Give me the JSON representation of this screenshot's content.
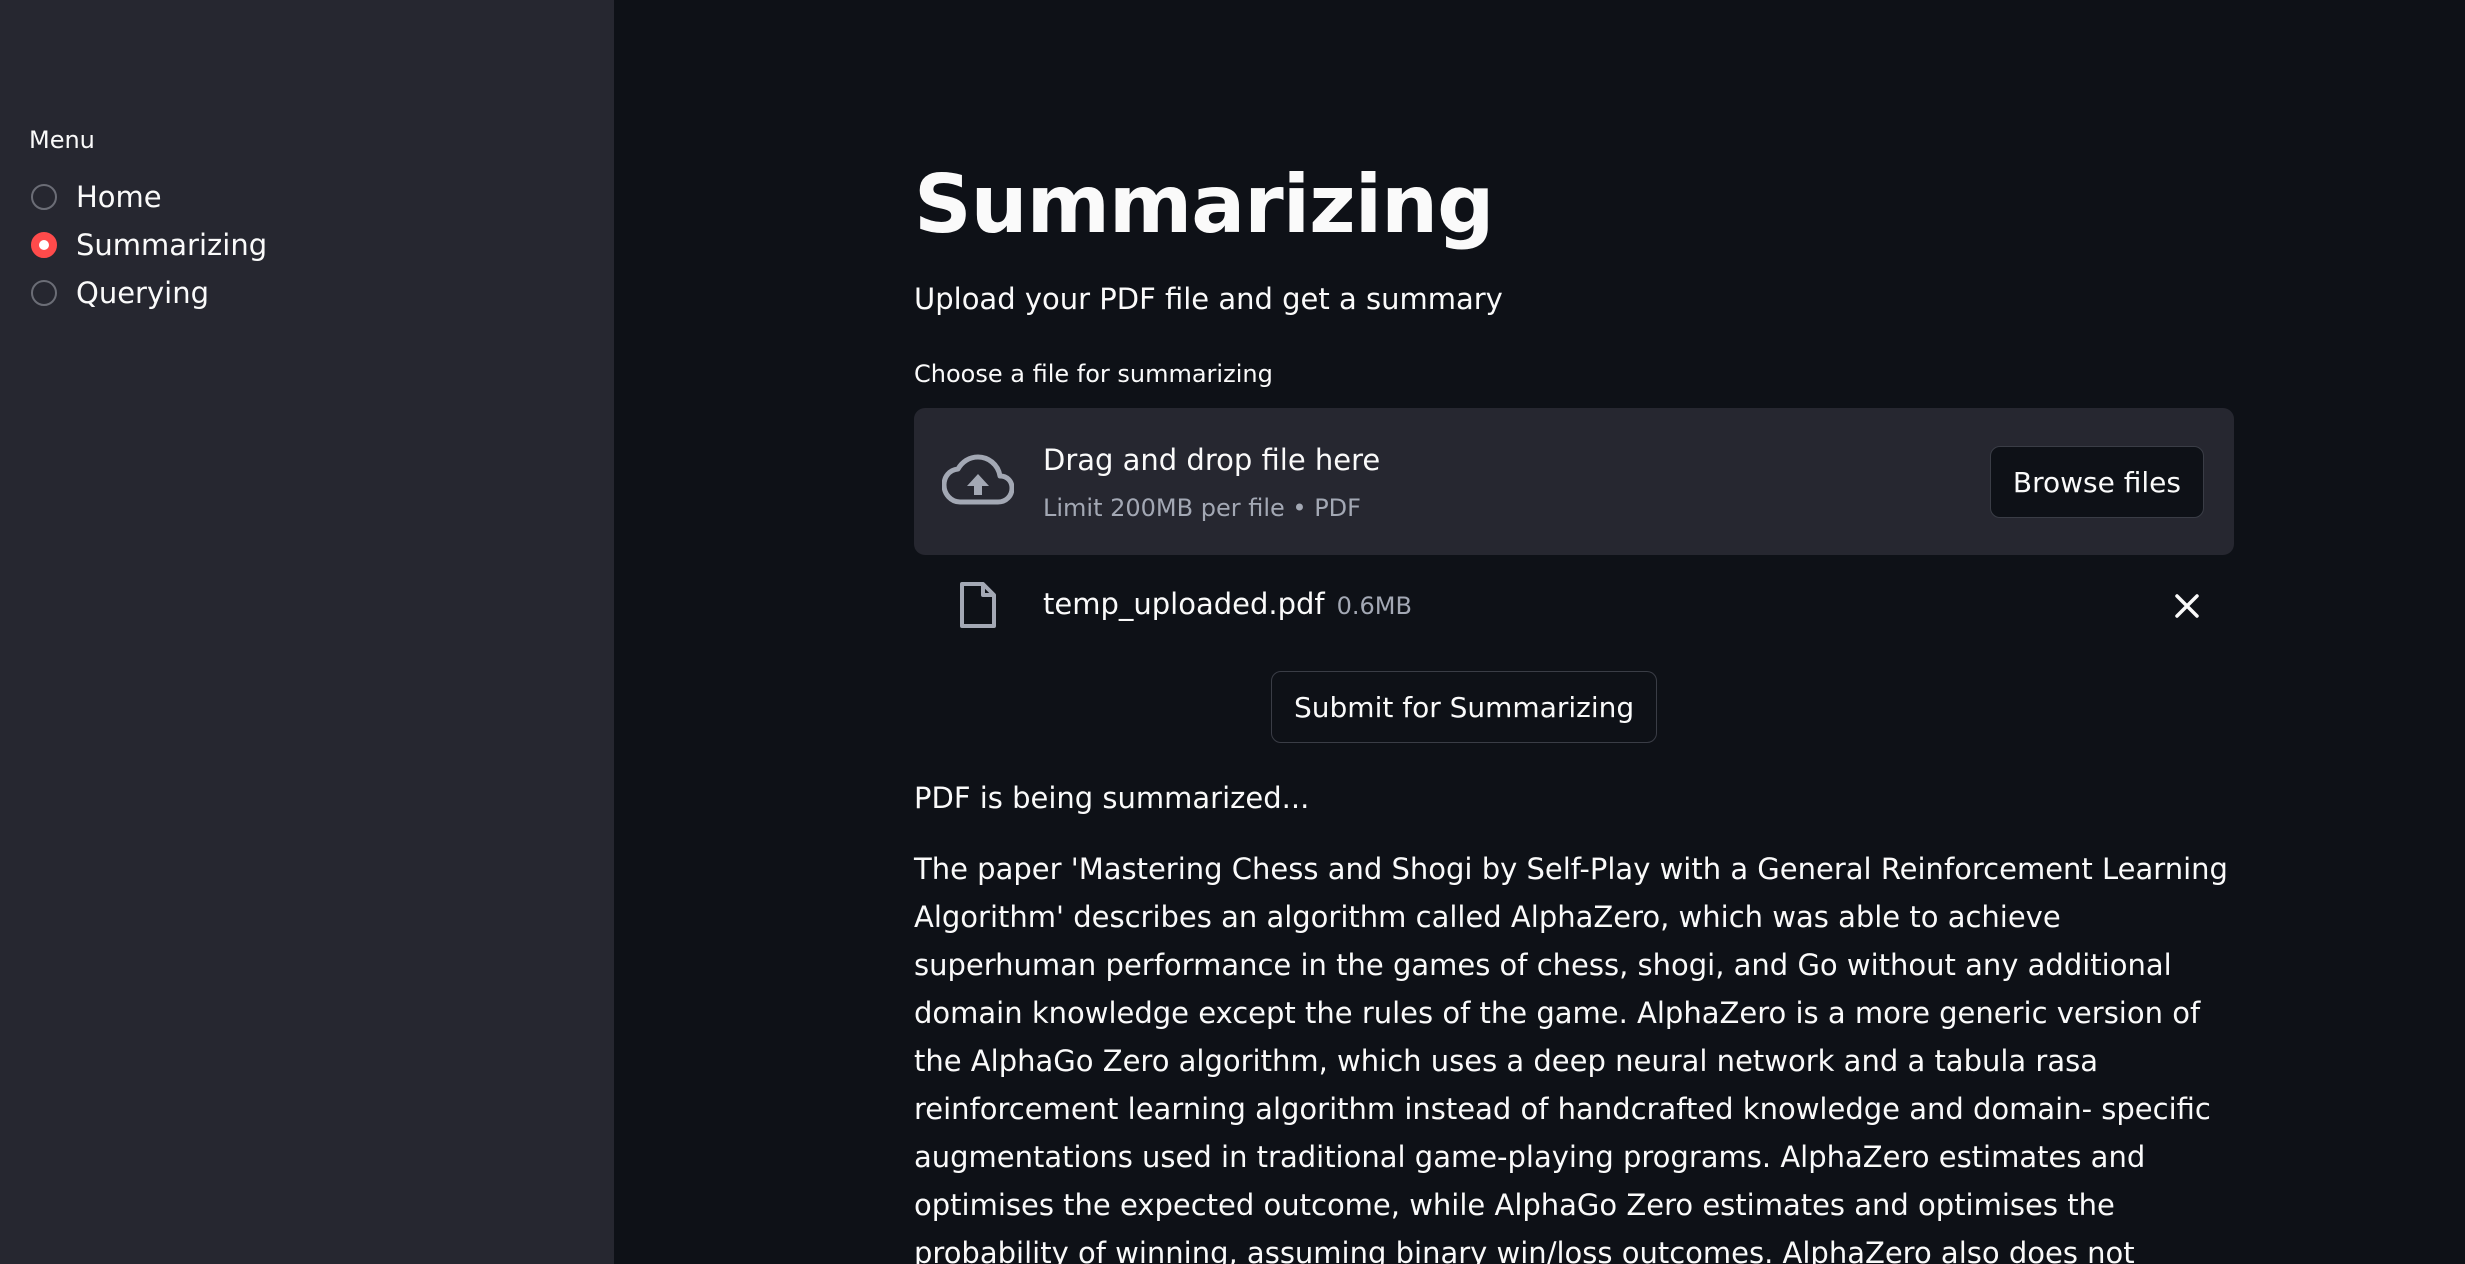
{
  "sidebar": {
    "menu_label": "Menu",
    "items": [
      {
        "label": "Home",
        "selected": false
      },
      {
        "label": "Summarizing",
        "selected": true
      },
      {
        "label": "Querying",
        "selected": false
      }
    ],
    "accent_color": "#ff4b4b"
  },
  "main": {
    "title": "Summarizing",
    "subtitle": "Upload your PDF file and get a summary",
    "uploader": {
      "label": "Choose a file for summarizing",
      "drag_text": "Drag and drop file here",
      "limit_text": "Limit 200MB per file • PDF",
      "browse_label": "Browse files",
      "icon": "cloud-upload-icon"
    },
    "uploaded_file": {
      "name": "temp_uploaded.pdf",
      "size": "0.6MB",
      "icon": "file-icon"
    },
    "submit_label": "Submit for Summarizing",
    "status_text": "PDF is being summarized...",
    "summary_text": "The paper 'Mastering Chess and Shogi by Self-Play with a General Reinforcement Learning Algorithm' describes an algorithm called AlphaZero, which was able to achieve superhuman performance in the games of chess, shogi, and Go without any additional domain knowledge except the rules of the game. AlphaZero is a more generic version of the AlphaGo Zero algorithm, which uses a deep neural network and a tabula rasa reinforcement learning algorithm instead of handcrafted knowledge and domain- specific augmentations used in traditional game-playing programs. AlphaZero estimates and optimises the expected outcome, while AlphaGo Zero estimates and optimises the probability of winning, assuming binary win/loss outcomes. AlphaZero also does not augment the training data or transform the board"
  }
}
